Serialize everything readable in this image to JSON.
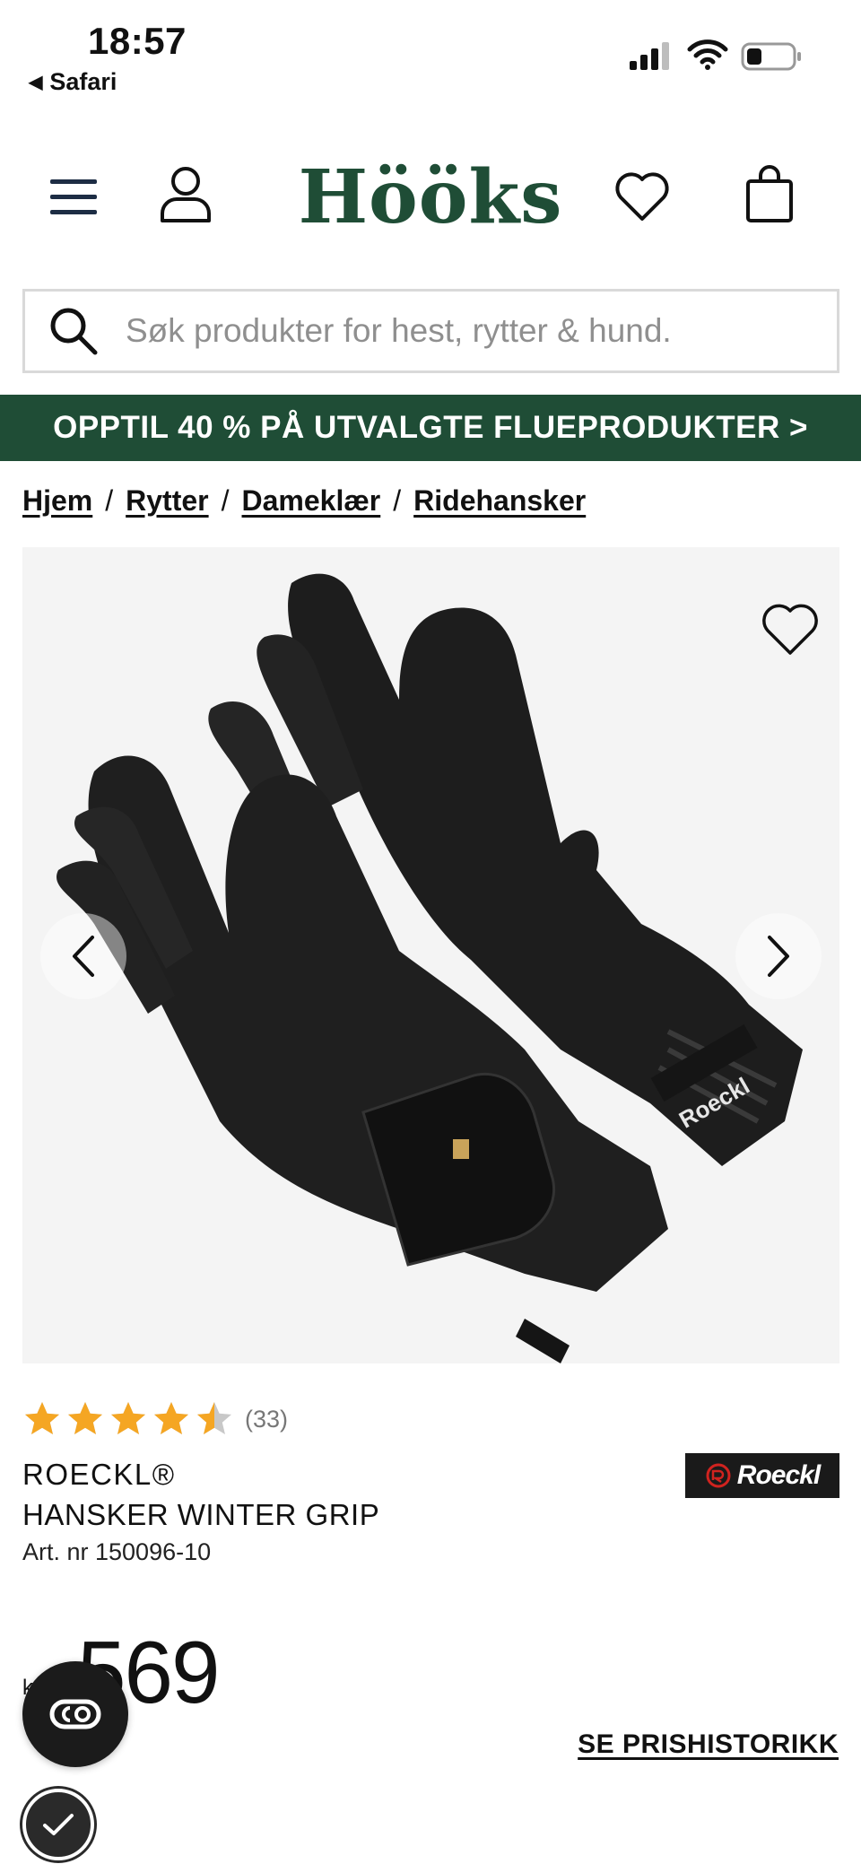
{
  "status_bar": {
    "time": "18:57",
    "back_app": "Safari",
    "icons": [
      "signal-icon",
      "wifi-icon",
      "battery-icon"
    ]
  },
  "header": {
    "logo": "Hööks",
    "icons": [
      "menu-icon",
      "user-icon",
      "heart-icon",
      "bag-icon"
    ]
  },
  "search": {
    "placeholder": "Søk produkter for hest, rytter & hund."
  },
  "promo": {
    "text": "OPPTIL 40 % PÅ UTVALGTE FLUEPRODUKTER >"
  },
  "breadcrumb": {
    "items": [
      "Hjem",
      "Rytter",
      "Dameklær",
      "Ridehansker"
    ],
    "separator": "/"
  },
  "product": {
    "rating_value": 4.5,
    "rating_max": 5,
    "rating_count": "(33)",
    "brand": "ROECKL®",
    "name": "HANSKER WINTER GRIP",
    "art_nr": "Art. nr 150096-10",
    "brand_logo_text": "Roeckl",
    "currency": "kr",
    "price": "569",
    "price_history_link": "SE PRISHISTORIKK"
  },
  "colors": {
    "brand_green": "#1f4d36",
    "star_gold": "#f5a623",
    "star_empty": "#c8c8c8",
    "text": "#111111"
  }
}
